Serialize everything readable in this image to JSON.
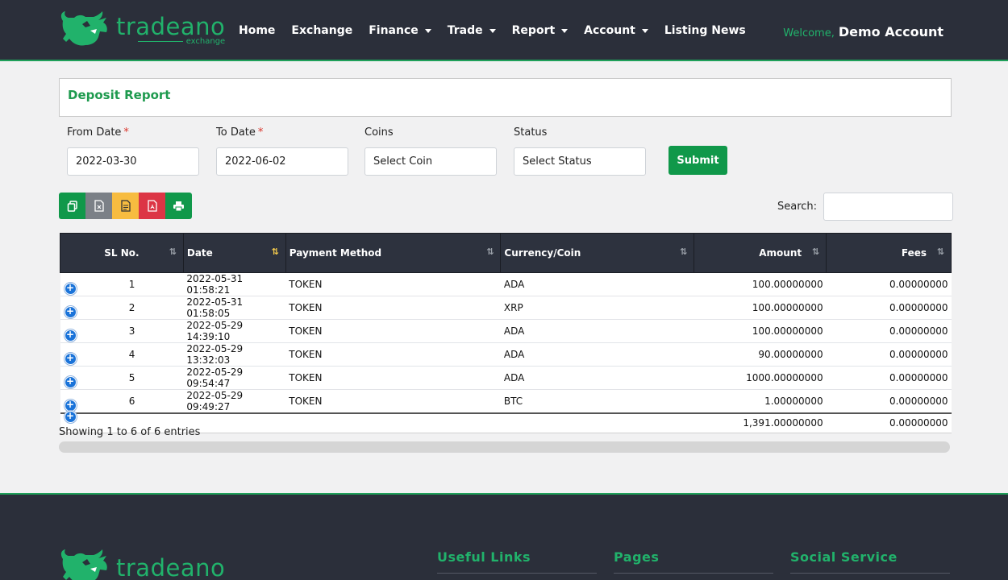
{
  "brand": {
    "name": "tradeano",
    "sub": "exchange"
  },
  "nav": {
    "items": [
      {
        "label": "Home",
        "dropdown": false
      },
      {
        "label": "Exchange",
        "dropdown": false
      },
      {
        "label": "Finance",
        "dropdown": true
      },
      {
        "label": "Trade",
        "dropdown": true
      },
      {
        "label": "Report",
        "dropdown": true
      },
      {
        "label": "Account",
        "dropdown": true
      },
      {
        "label": "Listing News",
        "dropdown": false
      }
    ]
  },
  "user": {
    "welcome": "Welcome,",
    "name": "Demo Account"
  },
  "report": {
    "title": "Deposit Report"
  },
  "filters": {
    "from_label": "From Date",
    "from_value": "2022-03-30",
    "to_label": "To Date",
    "to_value": "2022-06-02",
    "coins_label": "Coins",
    "coins_value": "Select Coin",
    "status_label": "Status",
    "status_value": "Select Status",
    "required_mark": "*",
    "submit": "Submit"
  },
  "search": {
    "label": "Search:"
  },
  "table": {
    "headers": [
      "SL No.",
      "Date",
      "Payment Method",
      "Currency/Coin",
      "Amount",
      "Fees"
    ],
    "rows": [
      [
        "1",
        "2022-05-31 01:58:21",
        "TOKEN",
        "ADA",
        "100.00000000",
        "0.00000000"
      ],
      [
        "2",
        "2022-05-31 01:58:05",
        "TOKEN",
        "XRP",
        "100.00000000",
        "0.00000000"
      ],
      [
        "3",
        "2022-05-29 14:39:10",
        "TOKEN",
        "ADA",
        "100.00000000",
        "0.00000000"
      ],
      [
        "4",
        "2022-05-29 13:32:03",
        "TOKEN",
        "ADA",
        "90.00000000",
        "0.00000000"
      ],
      [
        "5",
        "2022-05-29 09:54:47",
        "TOKEN",
        "ADA",
        "1000.00000000",
        "0.00000000"
      ],
      [
        "6",
        "2022-05-29 09:49:27",
        "TOKEN",
        "BTC",
        "1.00000000",
        "0.00000000"
      ]
    ],
    "totals": {
      "amount": "1,391.00000000",
      "fees": "0.00000000"
    }
  },
  "entries": "Showing 1 to 6 of 6 entries",
  "footer": {
    "columns": [
      "Useful Links",
      "Pages",
      "Social Service"
    ]
  },
  "colors": {
    "accent": "#21b26b",
    "header_bg": "#2b2f3a",
    "primary_btn": "#10984a"
  }
}
